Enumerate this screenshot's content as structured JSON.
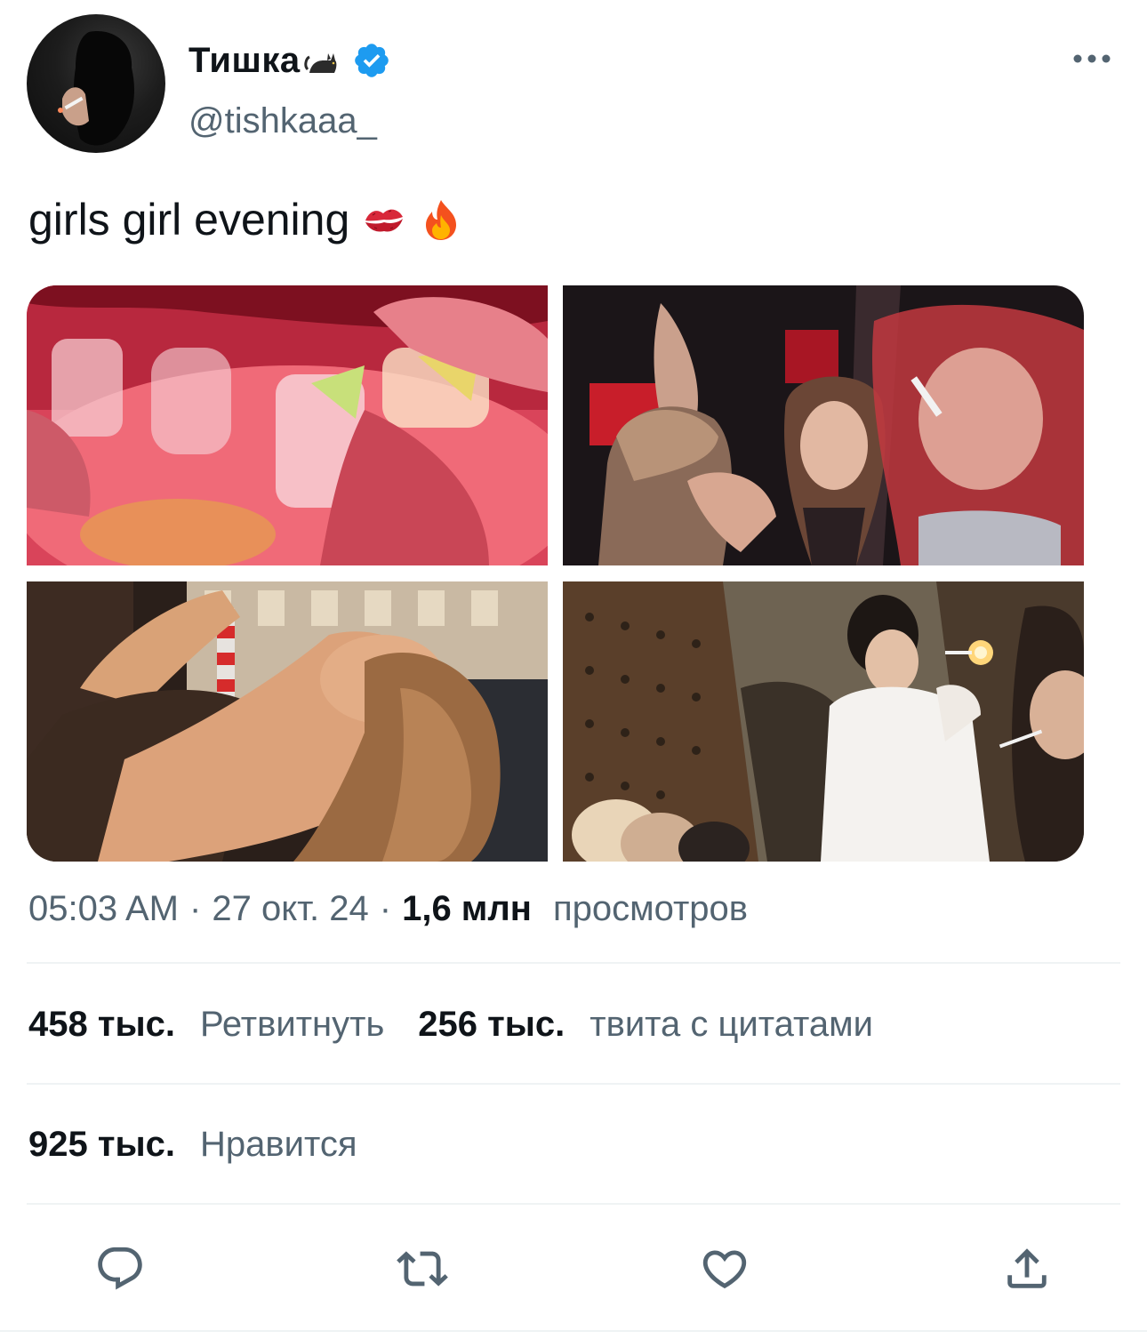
{
  "author": {
    "display_name": "Тишка",
    "name_emoji": "cat-emoji",
    "verified": true,
    "handle": "@tishkaaa_",
    "avatar": "profile-photo"
  },
  "tweet": {
    "text": "girls girl evening",
    "emojis": [
      "kiss-mark-emoji",
      "fire-emoji"
    ],
    "media": [
      {
        "name": "photo-shots-toast"
      },
      {
        "name": "photo-club-party"
      },
      {
        "name": "photo-street-night"
      },
      {
        "name": "photo-lighting-cigarettes"
      }
    ]
  },
  "meta": {
    "time": "05:03 AM",
    "separator": "·",
    "date": "27 окт. 24",
    "views_count": "1,6 млн",
    "views_label": "просмотров"
  },
  "stats": {
    "retweets_count": "458 тыс.",
    "retweets_label": "Ретвитнуть",
    "quotes_count": "256 тыс.",
    "quotes_label": "твита с цитатами",
    "likes_count": "925 тыс.",
    "likes_label": "Нравится"
  },
  "actions": [
    "reply-icon",
    "retweet-icon",
    "like-icon",
    "share-icon"
  ],
  "colors": {
    "text_primary": "#0f1419",
    "text_secondary": "#536471",
    "verified_blue": "#1d9bf0",
    "divider": "#eff3f4"
  }
}
